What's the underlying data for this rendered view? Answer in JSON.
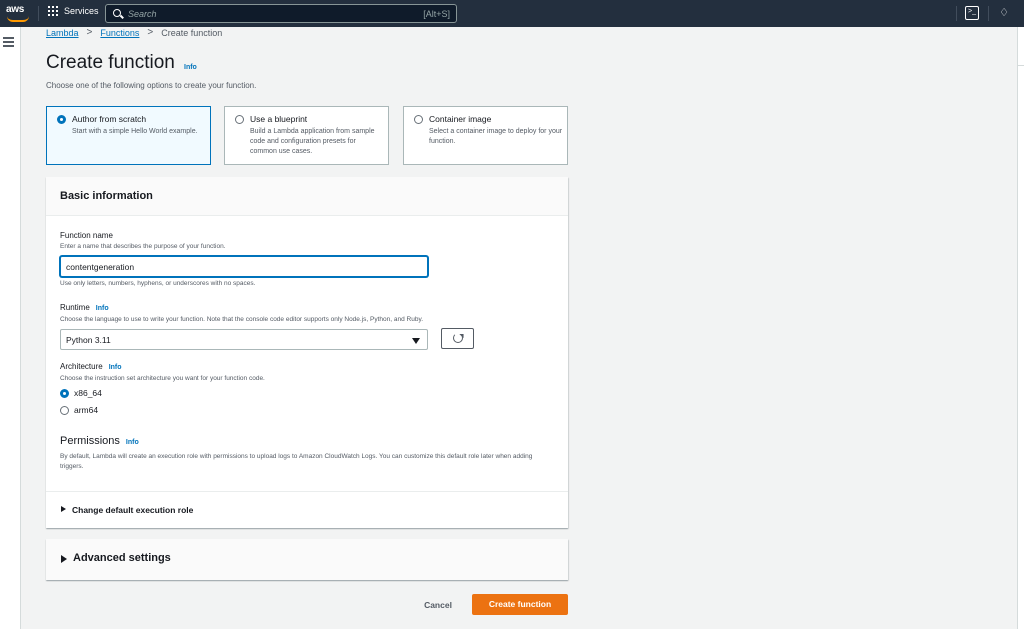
{
  "topbar": {
    "logo_text": "aws",
    "services_label": "Services",
    "search_placeholder": "Search",
    "search_shortcut": "[Alt+S]",
    "icons": [
      "grid-icon",
      "search-icon",
      "cloudshell-icon",
      "notifications-bell-icon"
    ]
  },
  "breadcrumb": {
    "items": [
      "Lambda",
      "Functions"
    ],
    "current": "Create function"
  },
  "page": {
    "title": "Create function",
    "info": "Info",
    "subtitle": "Choose one of the following options to create your function."
  },
  "creation_options": [
    {
      "label": "Author from scratch",
      "description": "Start with a simple Hello World example.",
      "selected": true
    },
    {
      "label": "Use a blueprint",
      "description": "Build a Lambda application from sample code and configuration presets for common use cases.",
      "selected": false
    },
    {
      "label": "Container image",
      "description": "Select a container image to deploy for your function.",
      "selected": false
    }
  ],
  "basic_info": {
    "title": "Basic information",
    "function_name": {
      "label": "Function name",
      "description": "Enter a name that describes the purpose of your function.",
      "value": "contentgeneration",
      "hint": "Use only letters, numbers, hyphens, or underscores with no spaces."
    },
    "runtime": {
      "label": "Runtime",
      "info": "Info",
      "description": "Choose the language to use to write your function. Note that the console code editor supports only Node.js, Python, and Ruby.",
      "selected": "Python 3.11"
    },
    "architecture": {
      "label": "Architecture",
      "info": "Info",
      "description": "Choose the instruction set architecture you want for your function code.",
      "options": [
        {
          "label": "x86_64",
          "selected": true
        },
        {
          "label": "arm64",
          "selected": false
        }
      ]
    },
    "permissions": {
      "title": "Permissions",
      "info": "Info",
      "description": "By default, Lambda will create an execution role with permissions to upload logs to Amazon CloudWatch Logs. You can customize this default role later when adding triggers."
    },
    "change_role_label": "Change default execution role"
  },
  "advanced_settings": {
    "label": "Advanced settings"
  },
  "actions": {
    "cancel": "Cancel",
    "create": "Create function"
  },
  "colors": {
    "topbar": "#232f3e",
    "accent": "#0073bb",
    "primary_button": "#ec7211"
  }
}
